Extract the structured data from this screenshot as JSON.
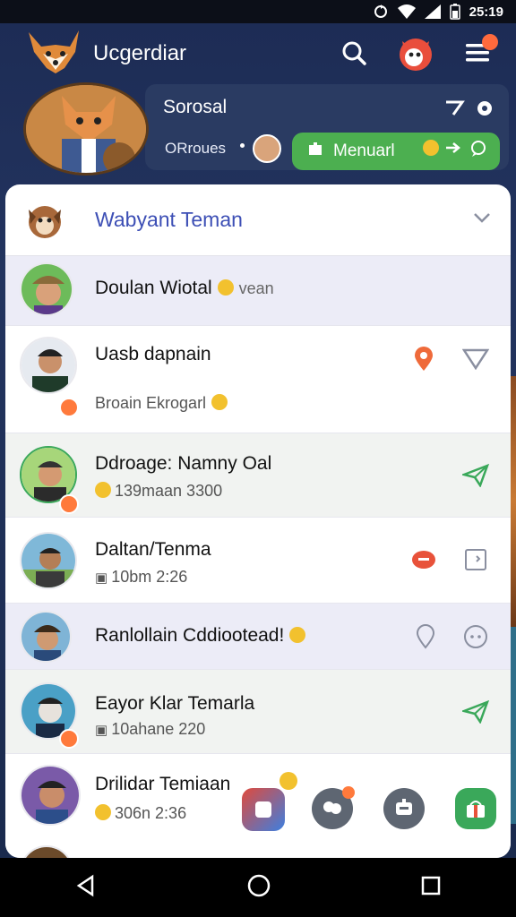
{
  "status": {
    "time": "25:19"
  },
  "app": {
    "title": "Ucgerdiar"
  },
  "profile": {
    "name": "Sorosal",
    "subtitle": "ORroues",
    "cta_label": "Menuarl"
  },
  "list": {
    "header_title": "Wabyant Teman",
    "rows": [
      {
        "name": "Doulan Wiotal",
        "name_suffix": "vean",
        "sub": ""
      },
      {
        "name": "Uasb dapnain",
        "sub": "Broain Ekrogarl"
      },
      {
        "name": "Ddroage: Namny Oal",
        "sub": "139maan 3300"
      },
      {
        "name": "Daltan/Tenma",
        "sub": "10bm 2:26"
      },
      {
        "name": "Ranlollain Cddiootead!",
        "sub": ""
      },
      {
        "name": "Eayor Klar Temarla",
        "sub": "10ahane 220"
      },
      {
        "name": "Drilidar Temiaan",
        "sub": "306n 2:36"
      }
    ]
  },
  "colors": {
    "accent": "#3d4fb5",
    "cta": "#4caf50",
    "badge": "#ff6a3d",
    "send": "#3aa85a"
  },
  "icons": [
    "search-icon",
    "notification-icon",
    "menu-icon",
    "location-icon",
    "send-icon",
    "chat-icon"
  ]
}
